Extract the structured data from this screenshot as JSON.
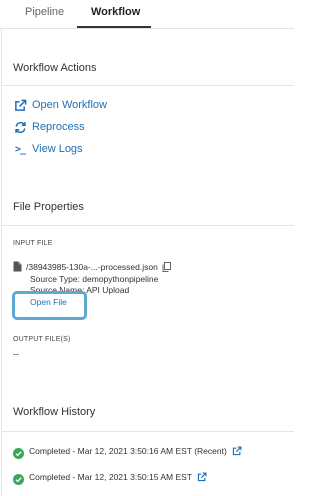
{
  "tabs": [
    {
      "label": "Pipeline",
      "active": false
    },
    {
      "label": "Workflow",
      "active": true
    }
  ],
  "workflow_actions": {
    "title": "Workflow Actions",
    "items": [
      {
        "label": "Open Workflow",
        "icon": "external-link-icon"
      },
      {
        "label": "Reprocess",
        "icon": "refresh-icon"
      },
      {
        "label": "View Logs",
        "icon": "terminal-icon"
      }
    ]
  },
  "file_properties": {
    "title": "File Properties",
    "input_label": "INPUT FILE",
    "file_name": "/38943985-130a-...-processed.json",
    "source_type": "Source Type: demopythonpipeline",
    "source_name": "Source Name: API Upload",
    "open_file_label": "Open File",
    "output_label": "OUTPUT FILE(S)",
    "output_value": "--"
  },
  "workflow_history": {
    "title": "Workflow History",
    "items": [
      {
        "text": "Completed - Mar 12, 2021 3:50:16 AM EST (Recent)",
        "status": "completed"
      },
      {
        "text": "Completed - Mar 12, 2021 3:50:15 AM EST",
        "status": "completed"
      }
    ]
  },
  "colors": {
    "link": "#1f6fb5",
    "success": "#3aa757",
    "highlight": "#5fa8d3"
  },
  "terminal_icon_glyph": ">_"
}
